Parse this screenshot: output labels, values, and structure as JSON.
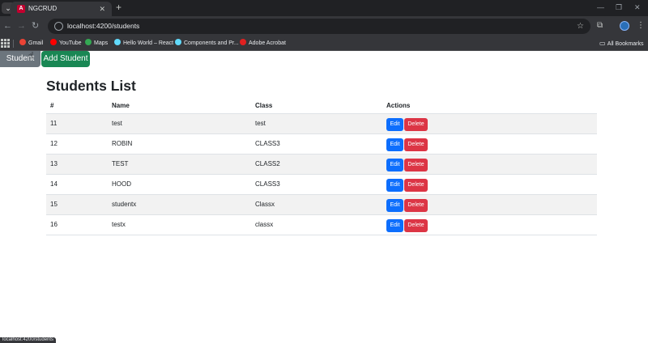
{
  "browser": {
    "tab_title": "NGCRUD",
    "tab_close": "✕",
    "new_tab": "+",
    "url": "localhost:4200/students",
    "bookmarks": [
      {
        "label": "Gmail",
        "icon": "gmail-icon",
        "color": "#ea4335"
      },
      {
        "label": "YouTube",
        "icon": "youtube-icon",
        "color": "#ff0000"
      },
      {
        "label": "Maps",
        "icon": "maps-icon",
        "color": "#34a853"
      },
      {
        "label": "Hello World – React",
        "icon": "react-icon",
        "color": "#61dafb"
      },
      {
        "label": "Components and Pr...",
        "icon": "react-icon",
        "color": "#61dafb"
      },
      {
        "label": "Adobe Acrobat",
        "icon": "acrobat-icon",
        "color": "#e02020"
      }
    ],
    "all_bookmarks": "All Bookmarks",
    "status_url": "localhost:4200/students"
  },
  "nav": {
    "student_list": "Student List",
    "add_student": "Add Student"
  },
  "page": {
    "title": "Students List"
  },
  "table": {
    "headers": [
      "#",
      "Name",
      "Class",
      "Actions"
    ],
    "edit_label": "Edit",
    "delete_label": "Delete",
    "rows": [
      {
        "id": "11",
        "name": "test",
        "class": "test"
      },
      {
        "id": "12",
        "name": "ROBIN",
        "class": "CLASS3"
      },
      {
        "id": "13",
        "name": "TEST",
        "class": "CLASS2"
      },
      {
        "id": "14",
        "name": "HOOD",
        "class": "CLASS3"
      },
      {
        "id": "15",
        "name": "studentx",
        "class": "Classx"
      },
      {
        "id": "16",
        "name": "testx",
        "class": "classx"
      }
    ]
  },
  "colors": {
    "edit": "#0d6efd",
    "delete": "#dc3545",
    "add": "#198754",
    "list": "#6c757d"
  }
}
